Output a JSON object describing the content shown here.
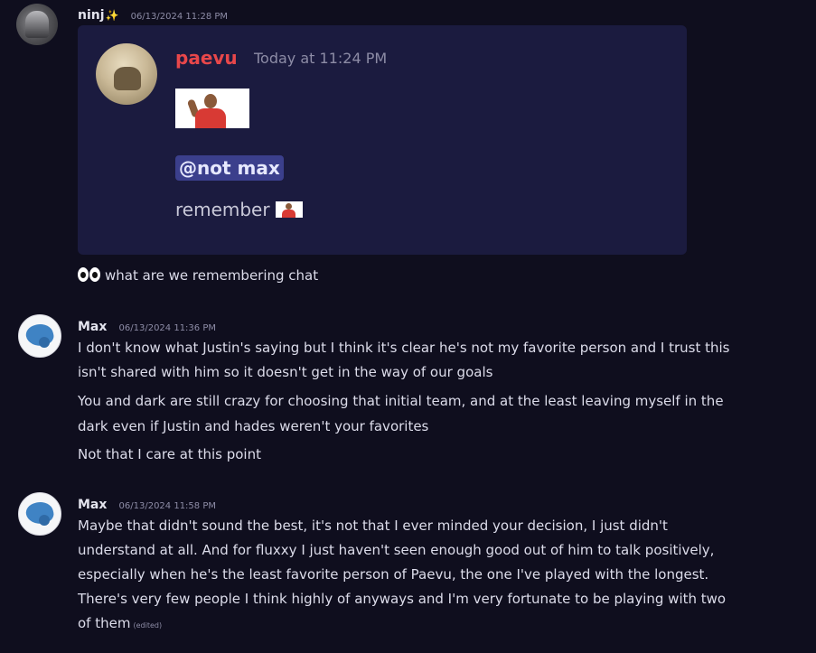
{
  "messages": [
    {
      "author": "ninj",
      "author_emoji": "✨",
      "timestamp": "06/13/2024 11:28 PM",
      "quoted": {
        "author": "paevu",
        "timestamp": "Today at 11:24 PM",
        "mention": "@not max",
        "text": "remember"
      },
      "lines": [
        "what are we remembering chat"
      ]
    },
    {
      "author": "Max",
      "timestamp": "06/13/2024 11:36 PM",
      "lines": [
        "I don't know what Justin's saying but I think it's clear he's not my favorite person and I trust this",
        "isn't shared with him so it doesn't get in the way of our goals",
        "You and dark are still crazy for choosing that initial team, and at the least leaving myself in the",
        "dark even if Justin and hades weren't your favorites",
        "Not that I care at this point"
      ]
    },
    {
      "author": "Max",
      "timestamp": "06/13/2024 11:58 PM",
      "lines": [
        "Maybe that didn't sound the best, it's not that I ever minded your decision, I just didn't",
        "understand at all. And for fluxxy I just haven't seen enough good out of him to talk positively,",
        "especially when he's the least favorite person of Paevu, the one I've played with the longest.",
        "There's very few people I think highly of anyways and I'm very fortunate to be playing with two",
        "of them"
      ],
      "edited_label": "(edited)"
    }
  ]
}
